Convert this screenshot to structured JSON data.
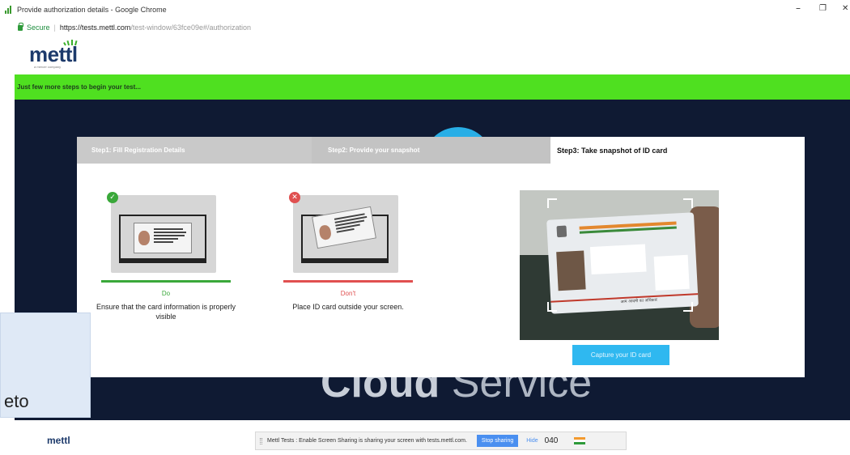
{
  "browser": {
    "window_title": "Provide authorization details - Google Chrome",
    "secure_label": "Secure",
    "url_host": "https://tests.mettl.com",
    "url_path": "/test-window/63fce09e#/authorization",
    "minimize_glyph": "–",
    "restore_glyph": "❐",
    "close_glyph": "✕"
  },
  "header": {
    "logo_text": "mettl",
    "logo_tagline": "a mercer company"
  },
  "banner": {
    "text": "Just few more steps to begin your test..."
  },
  "stage": {
    "background_text_bold": "Cloud",
    "background_text_light": " Service"
  },
  "modal": {
    "steps": [
      {
        "label": "Step1: Fill Registration Details",
        "state": "done"
      },
      {
        "label": "Step2: Provide your snapshot",
        "state": "done"
      },
      {
        "label": "Step3: Take snapshot of ID card",
        "state": "active"
      }
    ],
    "examples": [
      {
        "badge": "✓",
        "badge_color": "#3aa83a",
        "card_name": "Name: John Joseph",
        "label": "Do",
        "label_color": "#3aa83a",
        "bar_color": "#3aa83a",
        "description": "Ensure that the card information is properly visible"
      },
      {
        "badge": "✕",
        "badge_color": "#e05050",
        "card_name": "Name: John Joseph",
        "label": "Don't",
        "label_color": "#e05050",
        "bar_color": "#e05050",
        "description": "Place ID card outside your screen."
      }
    ],
    "id_card_footer_text": "आम आदमी का अधिकार",
    "capture_button": "Capture your ID card"
  },
  "overlay": {
    "text": "eto"
  },
  "footer": {
    "logo_text": "mettl",
    "share_message": "Mettl Tests : Enable Screen Sharing is sharing your screen with tests.mettl.com.",
    "stop_sharing": "Stop sharing",
    "hide": "Hide",
    "number": "040"
  },
  "colors": {
    "brand_green": "#4fe020",
    "navy": "#0f1a33",
    "accent_blue": "#2fb8f0",
    "logo_blue": "#1d3a6b"
  }
}
